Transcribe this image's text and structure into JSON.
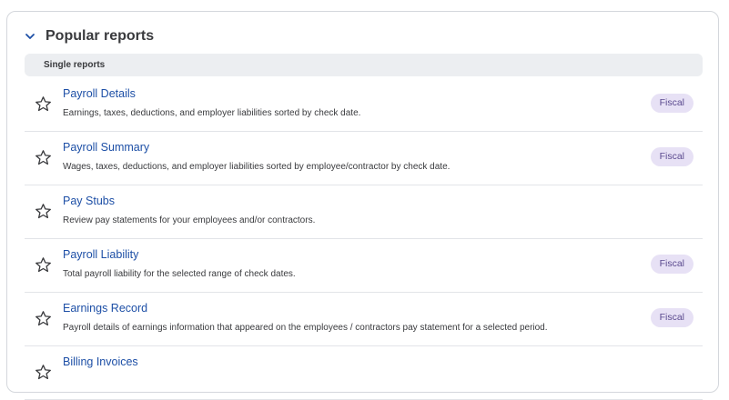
{
  "section": {
    "title": "Popular reports",
    "group_label": "Single reports"
  },
  "reports": [
    {
      "name": "Payroll Details",
      "description": "Earnings, taxes, deductions, and employer liabilities sorted by check date.",
      "badge": "Fiscal"
    },
    {
      "name": "Payroll Summary",
      "description": "Wages, taxes, deductions, and employer liabilities sorted by employee/contractor by check date.",
      "badge": "Fiscal"
    },
    {
      "name": "Pay Stubs",
      "description": "Review pay statements for your employees and/or contractors.",
      "badge": null
    },
    {
      "name": "Payroll Liability",
      "description": "Total payroll liability for the selected range of check dates.",
      "badge": "Fiscal"
    },
    {
      "name": "Earnings Record",
      "description": "Payroll details of earnings information that appeared on the employees / contractors pay statement for a selected period.",
      "badge": "Fiscal"
    },
    {
      "name": "Billing Invoices",
      "description": "",
      "badge": null
    }
  ],
  "icons": {
    "collapse": "chevron-down-icon",
    "favorite": "star-outline-icon"
  },
  "colors": {
    "link": "#1d4fa6",
    "badge_bg": "#e7e1f5",
    "badge_text": "#5b4a8f",
    "chevron": "#1d4fa6"
  }
}
